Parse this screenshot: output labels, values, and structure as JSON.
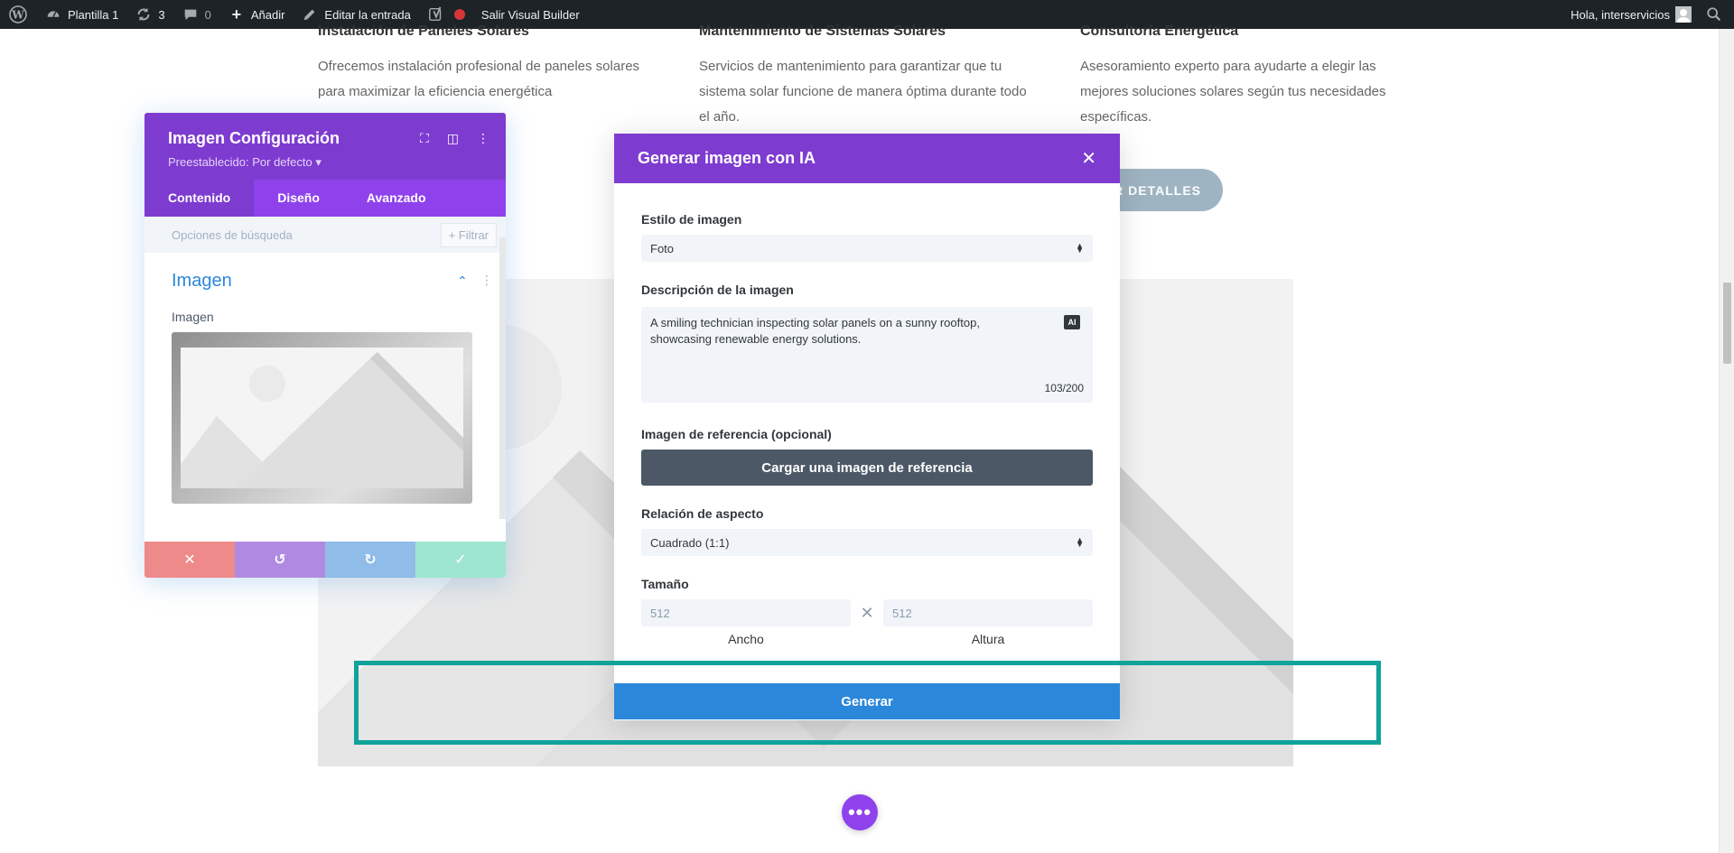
{
  "adminbar": {
    "site_name": "Plantilla 1",
    "updates_count": "3",
    "comments_count": "0",
    "add_label": "Añadir",
    "edit_label": "Editar la entrada",
    "exit_builder_label": "Salir Visual Builder",
    "greeting": "Hola, interservicios"
  },
  "services": [
    {
      "title": "Instalación de Paneles Solares",
      "text": "Ofrecemos instalación profesional de paneles solares para maximizar la eficiencia energética"
    },
    {
      "title": "Mantenimiento de Sistemas Solares",
      "text": "Servicios de mantenimiento para garantizar que tu sistema solar funcione de manera óptima durante todo el año."
    },
    {
      "title": "Consultoría Energética",
      "text": "Asesoramiento experto para ayudarte a elegir las mejores soluciones solares según tus necesidades específicas."
    }
  ],
  "details_button": "R DETALLES",
  "settings": {
    "title": "Imagen Configuración",
    "preset": "Preestablecido: Por defecto ▾",
    "tabs": [
      "Contenido",
      "Diseño",
      "Avanzado"
    ],
    "search_placeholder": "Opciones de búsqueda",
    "filter_label": "+ Filtrar",
    "section_title": "Imagen",
    "field_label": "Imagen"
  },
  "modal": {
    "title": "Generar imagen con IA",
    "style_label": "Estilo de imagen",
    "style_value": "Foto",
    "description_label": "Descripción de la imagen",
    "description_value": "A smiling technician inspecting solar panels on a sunny rooftop, showcasing renewable energy solutions.",
    "ai_badge": "AI",
    "char_count": "103/200",
    "reference_label": "Imagen de referencia (opcional)",
    "upload_button": "Cargar una imagen de referencia",
    "aspect_label": "Relación de aspecto",
    "aspect_value": "Cuadrado (1:1)",
    "size_label": "Tamaño",
    "width_placeholder": "512",
    "height_placeholder": "512",
    "width_label": "Ancho",
    "height_label": "Altura",
    "generate_button": "Generar"
  },
  "colors": {
    "adminbar_bg": "#1d2327",
    "divi_purple": "#7e3bd0",
    "divi_blue": "#2b87da",
    "highlight": "#10a39a"
  },
  "fab_label": "•••"
}
